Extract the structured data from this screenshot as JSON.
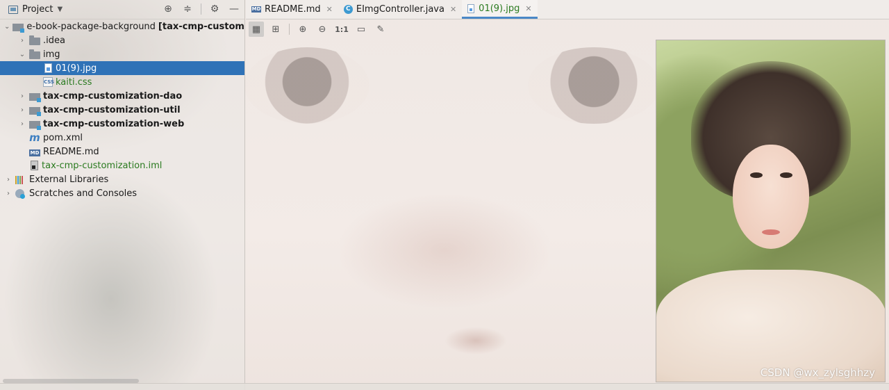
{
  "project_panel": {
    "title": "Project",
    "tools": [
      "locate-icon",
      "collapse-icon",
      "gear-icon",
      "minimize-icon"
    ]
  },
  "tree": {
    "root": "e-book-package-background",
    "root_suffix": "[tax-cmp-customizati",
    "items": [
      {
        "label": ".idea"
      },
      {
        "label": "img"
      },
      {
        "label": "01(9).jpg"
      },
      {
        "label": "kaiti.css"
      },
      {
        "label": "tax-cmp-customization-dao"
      },
      {
        "label": "tax-cmp-customization-util"
      },
      {
        "label": "tax-cmp-customization-web"
      },
      {
        "label": "pom.xml"
      },
      {
        "label": "README.md"
      },
      {
        "label": "tax-cmp-customization.iml"
      },
      {
        "label": "External Libraries"
      },
      {
        "label": "Scratches and Consoles"
      }
    ],
    "icon_badges": {
      "css": "CSS",
      "md": "MD",
      "maven": "m"
    }
  },
  "tabs": [
    {
      "label": "README.md",
      "badge": "MD"
    },
    {
      "label": "EImgController.java",
      "badge": "C"
    },
    {
      "label": "01(9).jpg",
      "active": true
    }
  ],
  "image_toolbar": {
    "actual_size_label": "1:1"
  },
  "watermark": "CSDN @wx_zylsghhzy",
  "colors": {
    "selection": "#2f72b7",
    "green_text": "#2a7a1f",
    "active_tab_underline": "#4a88c7"
  }
}
